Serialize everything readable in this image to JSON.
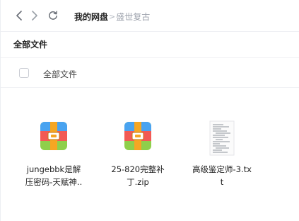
{
  "breadcrumb": {
    "root": "我的网盘",
    "separator": ">",
    "current": "盛世复古"
  },
  "section": {
    "title": "全部文件"
  },
  "list_header": {
    "column_label": "全部文件"
  },
  "files": [
    {
      "name_line1": "jungebbk是解",
      "name_line2": "压密码-天赋神..",
      "icon": "archive-zip-icon"
    },
    {
      "name_line1": "25-820完整补",
      "name_line2": "丁.zip",
      "icon": "archive-zip-icon"
    },
    {
      "name_line1": "高级鉴定师-3.tx",
      "name_line2": "t",
      "icon": "text-file-icon"
    }
  ],
  "colors": {
    "zip_top": "#49a3f0",
    "zip_middle": "#f25a55",
    "zip_bottom": "#8fcf4b",
    "zip_band": "#f5a623"
  }
}
